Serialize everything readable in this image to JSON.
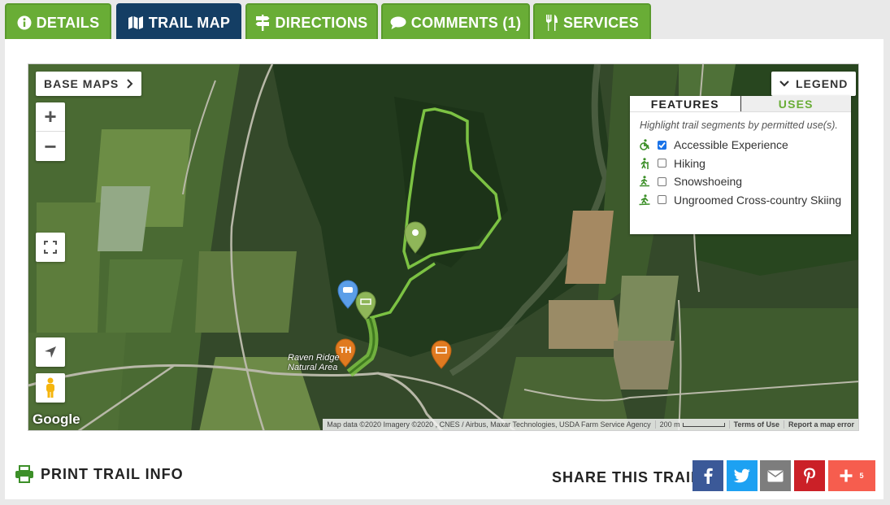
{
  "tabs": [
    {
      "label": "DETAILS",
      "icon": "info-icon",
      "active": false
    },
    {
      "label": "TRAIL MAP",
      "icon": "map-icon",
      "active": true
    },
    {
      "label": "DIRECTIONS",
      "icon": "signpost-icon",
      "active": false
    },
    {
      "label": "COMMENTS (1)",
      "icon": "comment-icon",
      "active": false
    },
    {
      "label": "SERVICES",
      "icon": "utensils-icon",
      "active": false
    }
  ],
  "map": {
    "base_maps_label": "BASE MAPS",
    "zoom_in": "+",
    "zoom_out": "−",
    "place_label": "Raven Ridge Natural Area",
    "google_logo": "Google",
    "attribution": "Map data ©2020 Imagery ©2020 , CNES / Airbus, Maxar Technologies, USDA Farm Service Agency",
    "scale_label": "200 m",
    "terms": "Terms of Use",
    "report": "Report a map error",
    "colors": {
      "trail": "#7cc243",
      "water": "#3a3f58"
    }
  },
  "legend": {
    "button_label": "LEGEND",
    "tab_features": "FEATURES",
    "tab_uses": "USES",
    "description": "Highlight trail segments by permitted use(s).",
    "items": [
      {
        "label": "Accessible Experience",
        "icon": "wheelchair-icon",
        "checked": true
      },
      {
        "label": "Hiking",
        "icon": "hiker-icon",
        "checked": false
      },
      {
        "label": "Snowshoeing",
        "icon": "snowshoe-icon",
        "checked": false
      },
      {
        "label": "Ungroomed Cross-country Skiing",
        "icon": "skier-icon",
        "checked": false
      }
    ]
  },
  "footer": {
    "print_label": "PRINT TRAIL INFO",
    "share_label": "SHARE THIS TRAIL",
    "share_count": "5",
    "share_buttons": [
      "facebook",
      "twitter",
      "email",
      "pinterest",
      "more"
    ]
  }
}
